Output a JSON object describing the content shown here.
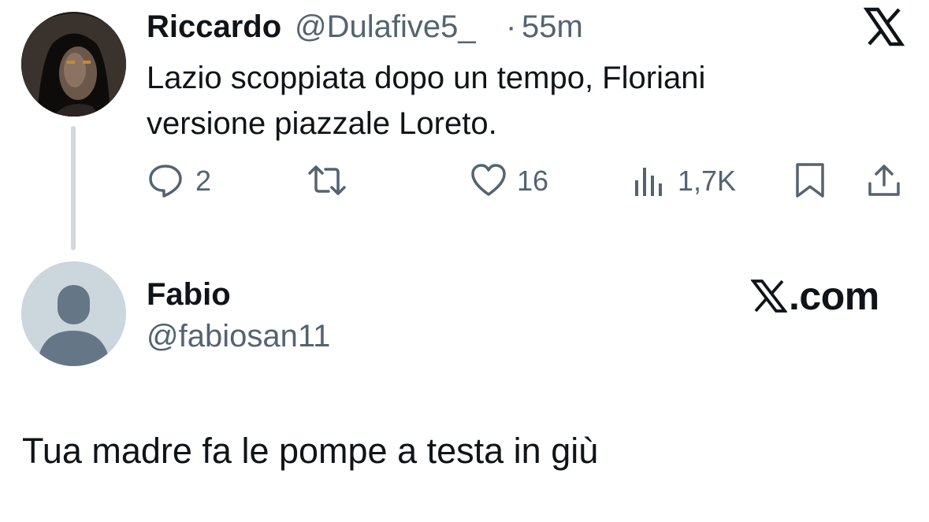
{
  "tweet": {
    "author_name": "Riccardo",
    "author_handle": "@Dulafive5_",
    "separator": "·",
    "time": "55m",
    "text": "Lazio scoppiata dopo un tempo, Floriani\nversione piazzale Loreto.",
    "actions": {
      "reply_count": "2",
      "retweet_count": "",
      "like_count": "16",
      "views_count": "1,7K"
    }
  },
  "reply_card": {
    "author_name": "Fabio",
    "author_handle": "@fabiosan11",
    "brand_text": ".com",
    "text": "Tua madre fa le pompe a testa in giù"
  },
  "icons": {
    "platform_logo": "x-logo-icon",
    "reply": "speech-bubble-icon",
    "retweet": "repost-arrows-icon",
    "like": "heart-icon",
    "views": "bar-chart-icon",
    "bookmark": "bookmark-icon",
    "share": "share-upload-icon"
  },
  "colors": {
    "text_primary": "#0f1419",
    "text_secondary": "#536471",
    "thread_line": "#cfd9de",
    "avatar_placeholder_bg": "#ccd6dd",
    "avatar_placeholder_fg": "#8899a6"
  }
}
